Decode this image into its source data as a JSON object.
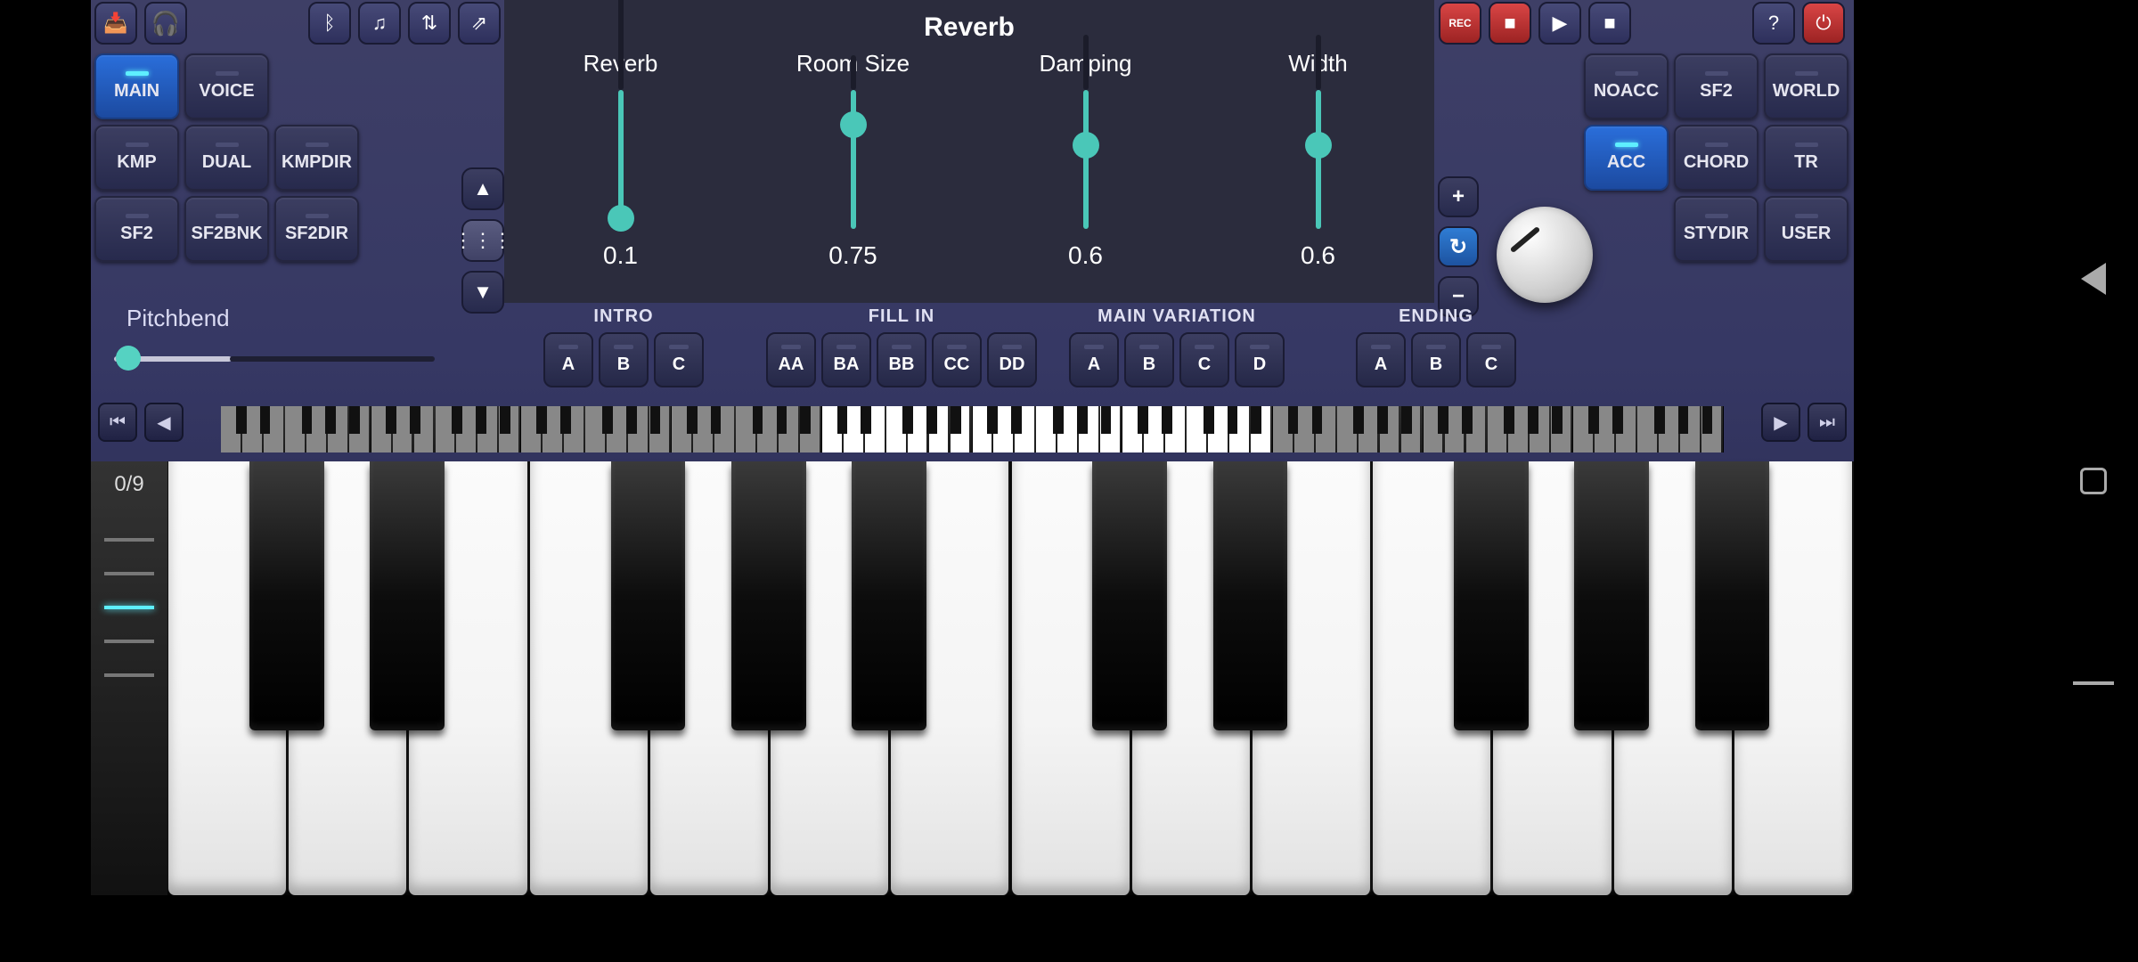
{
  "top_icons_left": [
    {
      "name": "folder-download-icon",
      "glyph": "📥"
    },
    {
      "name": "headphones-globe-icon",
      "glyph": "🎧"
    },
    {
      "name": "bluetooth-icon",
      "glyph": "ᛒ"
    },
    {
      "name": "music-note-icon",
      "glyph": "♫"
    },
    {
      "name": "equalizer-icon",
      "glyph": "⇅"
    },
    {
      "name": "share-icon",
      "glyph": "⇗"
    }
  ],
  "top_icons_right": [
    {
      "name": "record-button",
      "glyph": "REC",
      "class": "rec"
    },
    {
      "name": "stop-record-button",
      "glyph": "■",
      "class": "red"
    },
    {
      "name": "play-button",
      "glyph": "▶"
    },
    {
      "name": "stop-button",
      "glyph": "■"
    },
    {
      "name": "help-button",
      "glyph": "?"
    },
    {
      "name": "power-button",
      "glyph": "⏻",
      "class": "red"
    }
  ],
  "left_buttons": [
    {
      "label": "MAIN",
      "active": true
    },
    {
      "label": "VOICE"
    },
    {
      "label": ""
    },
    {
      "label": "KMP"
    },
    {
      "label": "DUAL"
    },
    {
      "label": "KMPDIR"
    },
    {
      "label": "SF2"
    },
    {
      "label": "SF2BNK"
    },
    {
      "label": "SF2DIR"
    }
  ],
  "right_buttons": [
    {
      "label": "NOACC"
    },
    {
      "label": "SF2"
    },
    {
      "label": "WORLD"
    },
    {
      "label": "ACC",
      "active": true
    },
    {
      "label": "CHORD"
    },
    {
      "label": "TR"
    },
    {
      "label": ""
    },
    {
      "label": "STYDIR"
    },
    {
      "label": "USER"
    }
  ],
  "pitchbend": {
    "label": "Pitchbend",
    "value": 0.0
  },
  "reverb": {
    "title": "Reverb",
    "params": [
      {
        "name": "Reverb",
        "value": "0.1",
        "pos": 0.08
      },
      {
        "name": "Room Size",
        "value": "0.75",
        "pos": 0.75
      },
      {
        "name": "Damping",
        "value": "0.6",
        "pos": 0.6
      },
      {
        "name": "Width",
        "value": "0.6",
        "pos": 0.6
      }
    ]
  },
  "panel_nav": {
    "up": "▲",
    "grid": "⋮⋮⋮",
    "down": "▼",
    "plus": "+",
    "refresh": "↻",
    "minus": "−"
  },
  "arranger": {
    "groups": [
      {
        "label": "INTRO",
        "buttons": [
          "A",
          "B",
          "C"
        ]
      },
      {
        "label": "FILL IN",
        "buttons": [
          "AA",
          "BA",
          "BB",
          "CC",
          "DD"
        ]
      },
      {
        "label": "MAIN VARIATION",
        "buttons": [
          "A",
          "B",
          "C",
          "D"
        ]
      },
      {
        "label": "ENDING",
        "buttons": [
          "A",
          "B",
          "C"
        ]
      }
    ]
  },
  "kb_nav": {
    "rewind": "⏮",
    "left": "◀",
    "right": "▶",
    "fastfwd": "⏭"
  },
  "octave_label": "0/9",
  "overview": {
    "octaves": 10,
    "highlight": [
      4,
      5,
      6
    ]
  },
  "velocity_levels": [
    false,
    false,
    true,
    false,
    false
  ],
  "main_keyboard": {
    "white_keys": 14
  }
}
